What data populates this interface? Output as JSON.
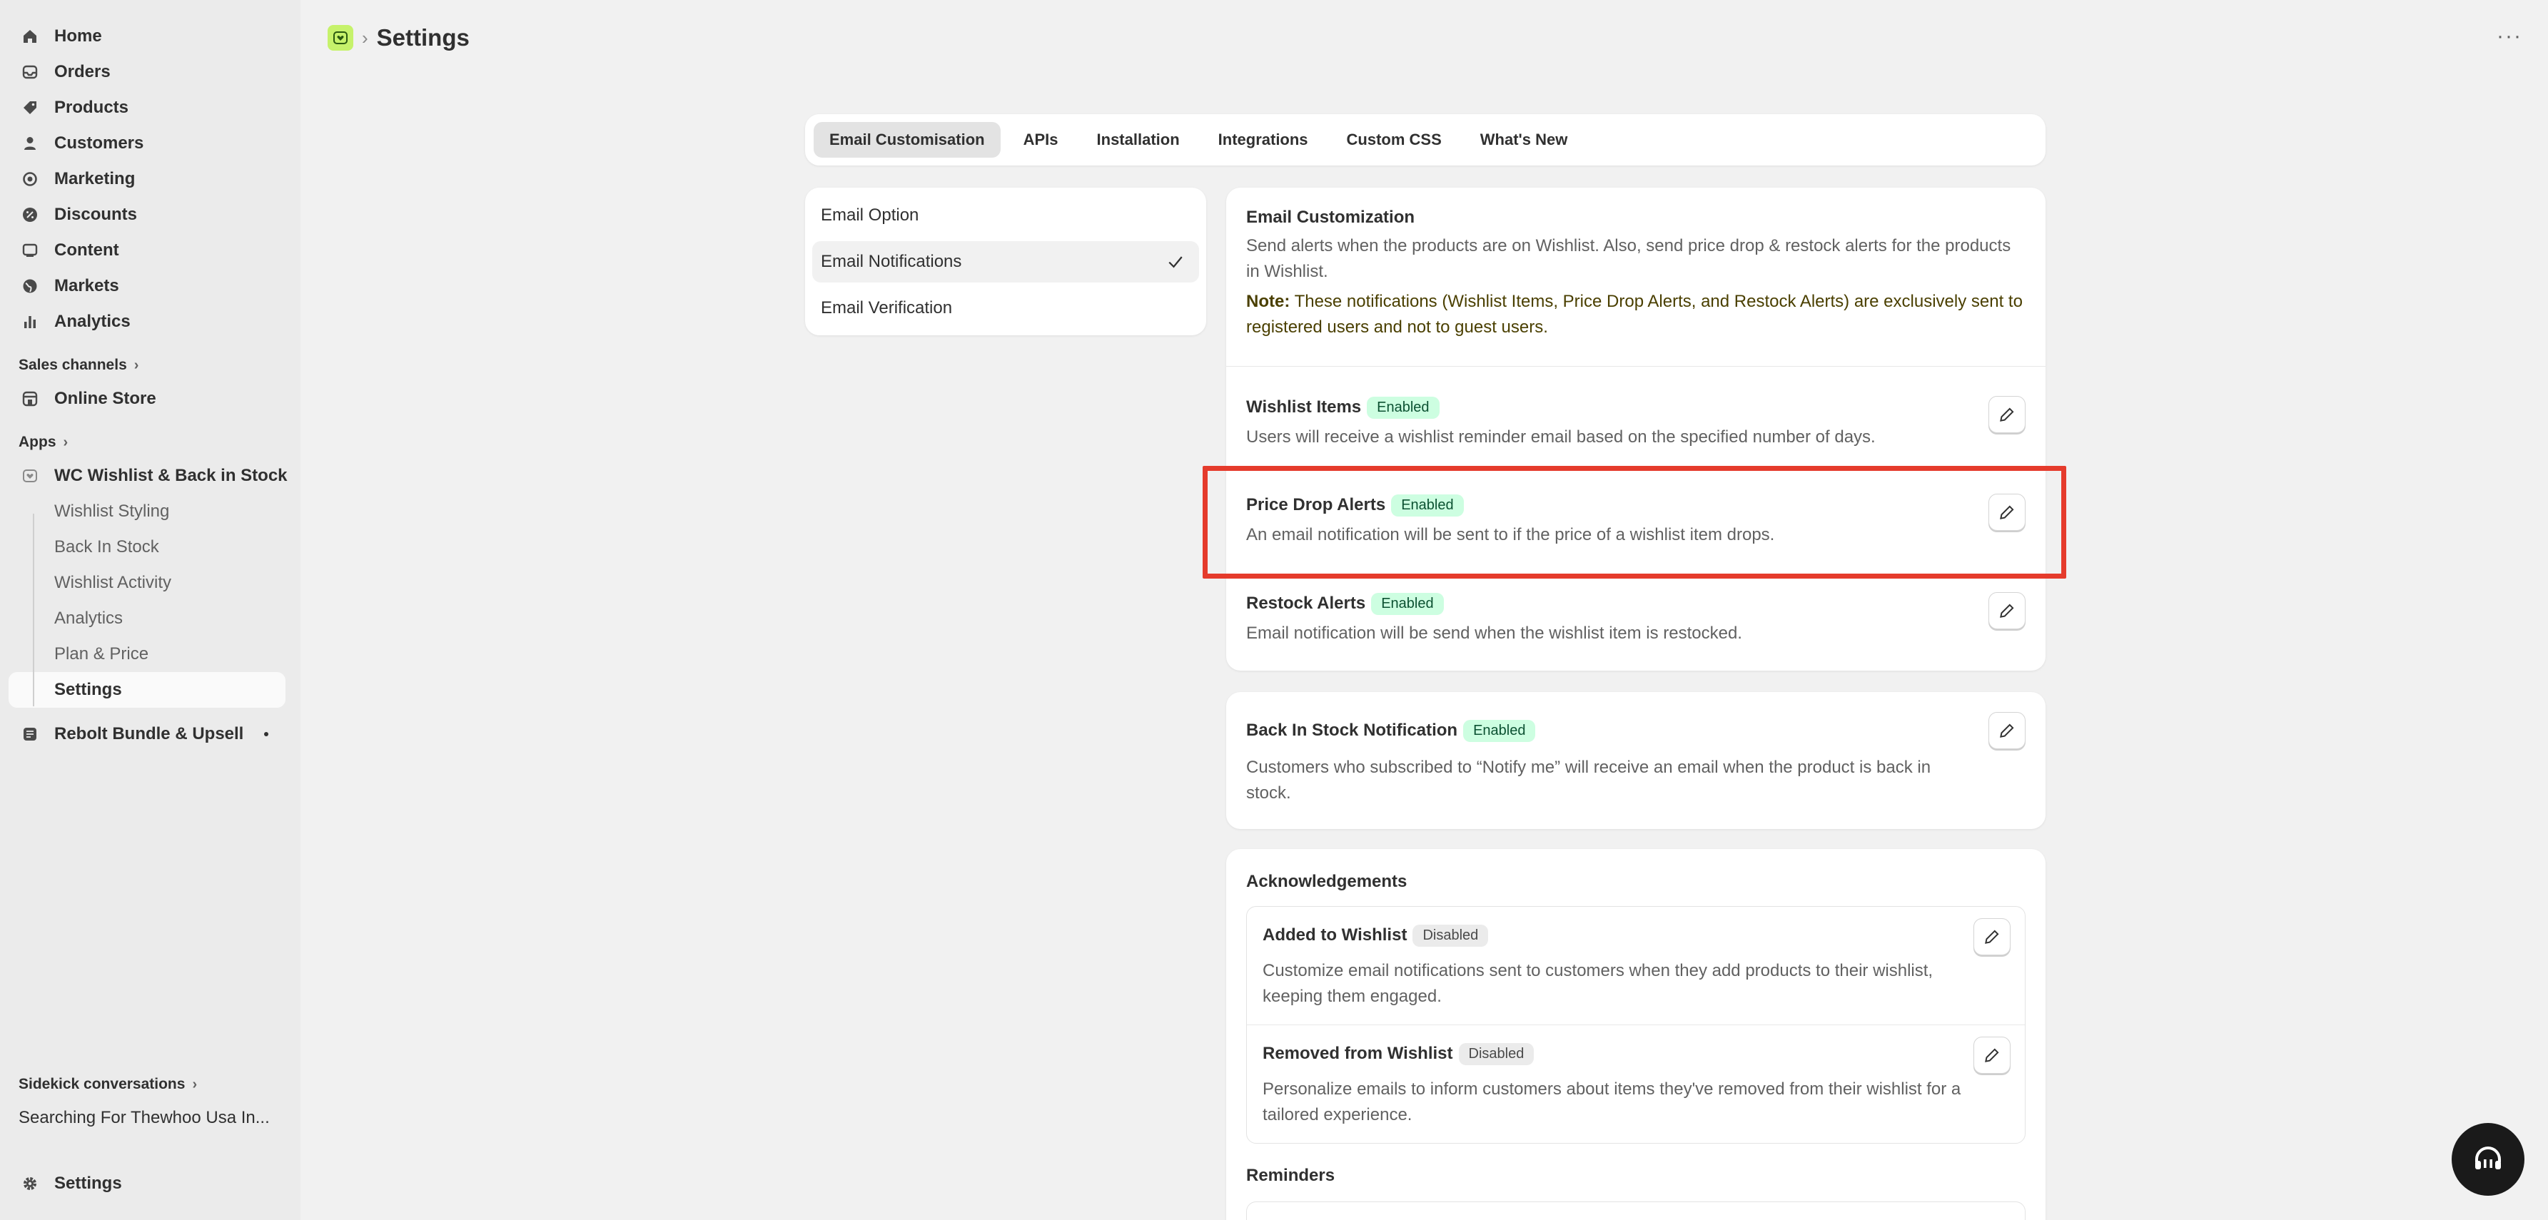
{
  "sidebar": {
    "nav": [
      {
        "label": "Home",
        "icon": "home-icon"
      },
      {
        "label": "Orders",
        "icon": "inbox-icon"
      },
      {
        "label": "Products",
        "icon": "tag-icon"
      },
      {
        "label": "Customers",
        "icon": "person-icon"
      },
      {
        "label": "Marketing",
        "icon": "target-icon"
      },
      {
        "label": "Discounts",
        "icon": "discount-icon"
      },
      {
        "label": "Content",
        "icon": "image-icon"
      },
      {
        "label": "Markets",
        "icon": "globe-icon"
      },
      {
        "label": "Analytics",
        "icon": "bar-chart-icon"
      }
    ],
    "sales_channels_label": "Sales channels",
    "online_store_label": "Online Store",
    "apps_label": "Apps",
    "app_name": "WC Wishlist & Back in Stock",
    "app_subitems": [
      "Wishlist Styling",
      "Back In Stock",
      "Wishlist Activity",
      "Analytics",
      "Plan & Price",
      "Settings"
    ],
    "second_app": "Rebolt Bundle & Upsell",
    "sidekick_label": "Sidekick conversations",
    "sidekick_item": "Searching For Thewhoo Usa In...",
    "settings_label": "Settings"
  },
  "header": {
    "title": "Settings",
    "separator": "›",
    "more": "···"
  },
  "tabs": [
    "Email Customisation",
    "APIs",
    "Installation",
    "Integrations",
    "Custom CSS",
    "What's New"
  ],
  "email_options": [
    "Email Option",
    "Email Notifications",
    "Email Verification"
  ],
  "customization": {
    "title": "Email Customization",
    "description": "Send alerts when the products are on Wishlist. Also, send price drop & restock alerts for the products in Wishlist.",
    "note_label": "Note:",
    "note_text": "These notifications (Wishlist Items, Price Drop Alerts, and Restock Alerts) are exclusively sent to registered users and not to guest users.",
    "items": [
      {
        "title": "Wishlist Items",
        "status": "Enabled",
        "desc": "Users will receive a wishlist reminder email based on the specified number of days."
      },
      {
        "title": "Price Drop Alerts",
        "status": "Enabled",
        "desc": "An email notification will be sent to if the price of a wishlist item drops."
      },
      {
        "title": "Restock Alerts",
        "status": "Enabled",
        "desc": "Email notification will be send when the wishlist item is restocked."
      }
    ]
  },
  "back_in_stock": {
    "title": "Back In Stock Notification",
    "status": "Enabled",
    "desc": "Customers who subscribed to “Notify me” will receive an email when the product is back in stock."
  },
  "acknowledgements": {
    "title": "Acknowledgements",
    "items": [
      {
        "title": "Added to Wishlist",
        "status": "Disabled",
        "desc": "Customize email notifications sent to customers when they add products to their wishlist, keeping them engaged."
      },
      {
        "title": "Removed from Wishlist",
        "status": "Disabled",
        "desc": "Personalize emails to inform customers about items they've removed from their wishlist for a tailored experience."
      }
    ]
  },
  "reminders": {
    "title": "Reminders"
  },
  "colors": {
    "highlight": "#e53b2c",
    "enabled_bg": "#cdfee1",
    "app_logo": "#c6f26b"
  }
}
